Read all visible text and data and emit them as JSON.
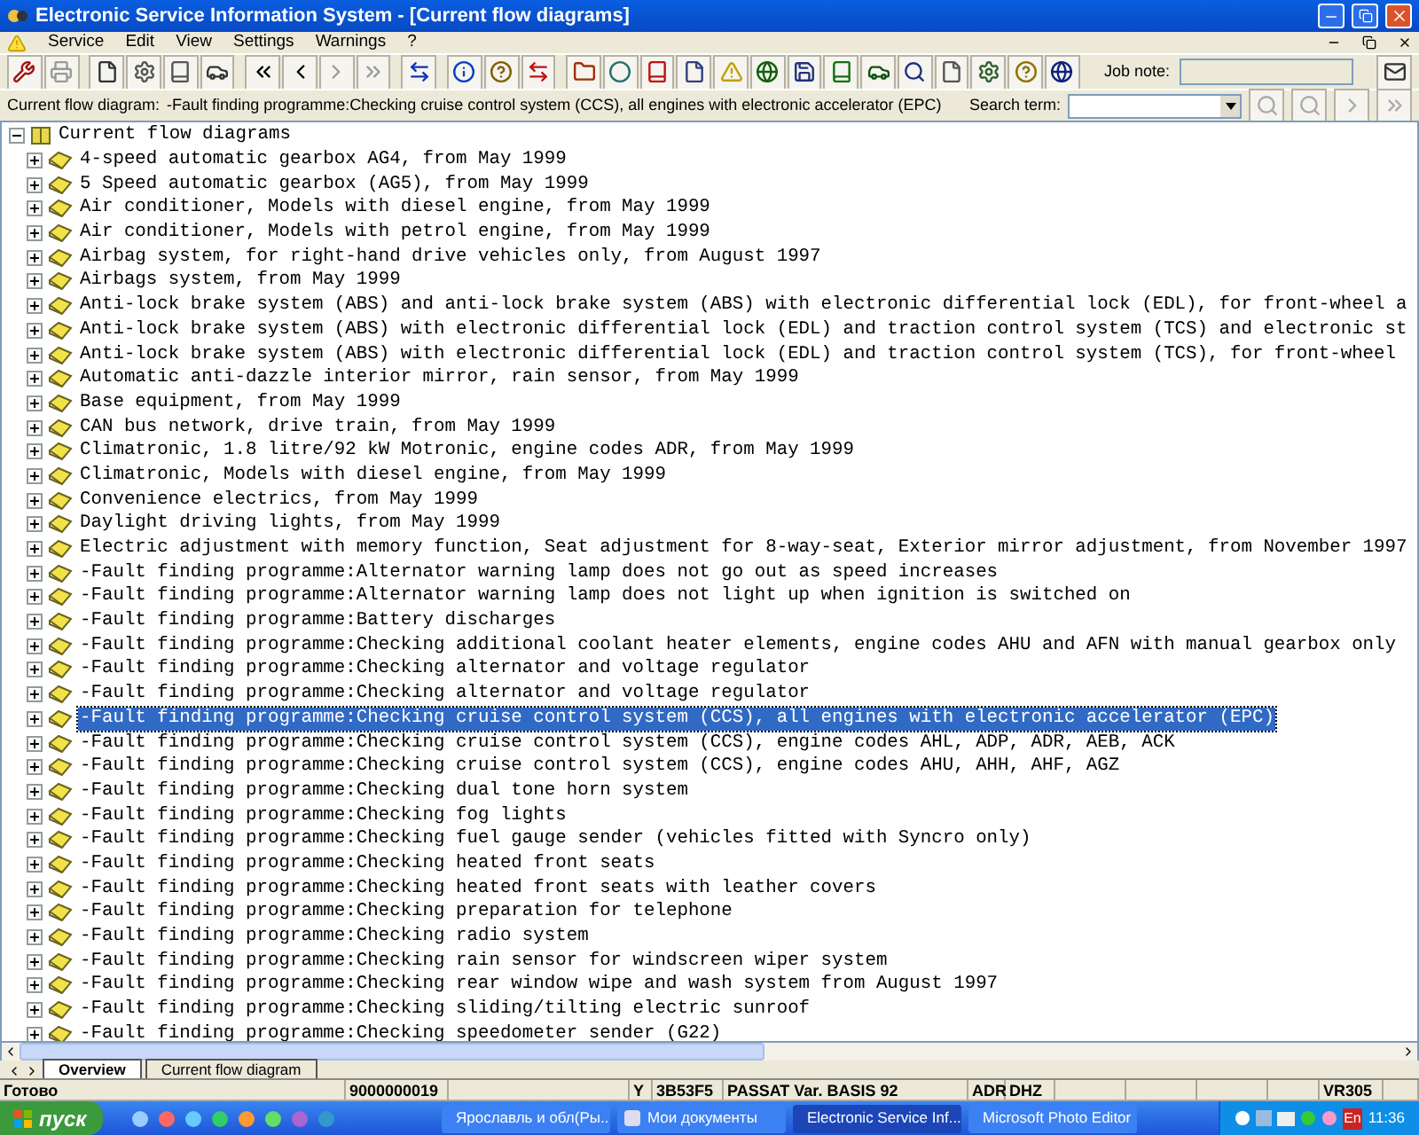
{
  "window": {
    "title": "Electronic Service Information System - [Current flow diagrams]"
  },
  "menu": [
    {
      "label": "Service"
    },
    {
      "label": "Edit"
    },
    {
      "label": "View"
    },
    {
      "label": "Settings"
    },
    {
      "label": "Warnings"
    },
    {
      "label": "?"
    }
  ],
  "toolbar": {
    "job_note_label": "Job note:"
  },
  "info_bar": {
    "label": "Current flow diagram:",
    "value": "-Fault finding programme:Checking cruise control system (CCS), all engines with electronic accelerator (EPC)",
    "search_label": "Search term:"
  },
  "tree": {
    "label": "Current flow diagrams",
    "expanded": true,
    "children": [
      {
        "label": "4-speed automatic gearbox AG4, from May 1999",
        "expanded": false,
        "selected": false
      },
      {
        "label": "5 Speed automatic gearbox (AG5), from May 1999",
        "expanded": false,
        "selected": false
      },
      {
        "label": "Air conditioner, Models with diesel engine, from May 1999",
        "expanded": false,
        "selected": false
      },
      {
        "label": "Air conditioner, Models with petrol engine, from May 1999",
        "expanded": false,
        "selected": false
      },
      {
        "label": "Airbag system, for right-hand drive vehicles only, from August 1997",
        "expanded": false,
        "selected": false
      },
      {
        "label": "Airbags system, from May 1999",
        "expanded": false,
        "selected": false
      },
      {
        "label": "Anti-lock brake system (ABS) and anti-lock brake system (ABS) with electronic differential lock (EDL), for front-wheel a",
        "expanded": false,
        "selected": false
      },
      {
        "label": "Anti-lock brake system (ABS) with electronic differential lock (EDL) and traction control system (TCS) and electronic st",
        "expanded": false,
        "selected": false
      },
      {
        "label": "Anti-lock brake system (ABS) with electronic differential lock (EDL) and traction control system (TCS), for front-wheel",
        "expanded": false,
        "selected": false
      },
      {
        "label": "Automatic anti-dazzle interior mirror, rain sensor, from May 1999",
        "expanded": false,
        "selected": false
      },
      {
        "label": "Base equipment, from May 1999",
        "expanded": false,
        "selected": false
      },
      {
        "label": "CAN bus network, drive train, from May 1999",
        "expanded": false,
        "selected": false
      },
      {
        "label": "Climatronic, 1.8 litre/92 kW Motronic, engine codes ADR, from May 1999",
        "expanded": false,
        "selected": false
      },
      {
        "label": "Climatronic, Models with diesel engine, from May 1999",
        "expanded": false,
        "selected": false
      },
      {
        "label": "Convenience electrics, from May 1999",
        "expanded": false,
        "selected": false
      },
      {
        "label": "Daylight driving lights, from May 1999",
        "expanded": false,
        "selected": false
      },
      {
        "label": "Electric adjustment with memory function, Seat adjustment for 8-way-seat, Exterior mirror adjustment, from November 1997",
        "expanded": false,
        "selected": false
      },
      {
        "label": "-Fault finding programme:Alternator warning lamp does not go out as speed increases",
        "expanded": false,
        "selected": false
      },
      {
        "label": "-Fault finding programme:Alternator warning lamp does not light up when ignition is switched on",
        "expanded": false,
        "selected": false
      },
      {
        "label": "-Fault finding programme:Battery discharges",
        "expanded": false,
        "selected": false
      },
      {
        "label": "-Fault finding programme:Checking additional coolant heater elements, engine codes AHU and AFN with manual gearbox only",
        "expanded": false,
        "selected": false
      },
      {
        "label": "-Fault finding programme:Checking alternator and voltage regulator",
        "expanded": false,
        "selected": false
      },
      {
        "label": "-Fault finding programme:Checking alternator and voltage regulator",
        "expanded": false,
        "selected": false
      },
      {
        "label": "-Fault finding programme:Checking cruise control system (CCS), all engines with electronic accelerator (EPC)",
        "expanded": false,
        "selected": true
      },
      {
        "label": "-Fault finding programme:Checking cruise control system (CCS), engine codes AHL, ADP, ADR, AEB, ACK",
        "expanded": false,
        "selected": false
      },
      {
        "label": "-Fault finding programme:Checking cruise control system (CCS), engine codes AHU, AHH, AHF, AGZ",
        "expanded": false,
        "selected": false
      },
      {
        "label": "-Fault finding programme:Checking dual tone horn system",
        "expanded": false,
        "selected": false
      },
      {
        "label": "-Fault finding programme:Checking fog lights",
        "expanded": false,
        "selected": false
      },
      {
        "label": "-Fault finding programme:Checking fuel gauge sender (vehicles fitted with Syncro only)",
        "expanded": false,
        "selected": false
      },
      {
        "label": "-Fault finding programme:Checking heated front seats",
        "expanded": false,
        "selected": false
      },
      {
        "label": "-Fault finding programme:Checking heated front seats with leather covers",
        "expanded": false,
        "selected": false
      },
      {
        "label": "-Fault finding programme:Checking preparation for telephone",
        "expanded": false,
        "selected": false
      },
      {
        "label": "-Fault finding programme:Checking radio system",
        "expanded": false,
        "selected": false
      },
      {
        "label": "-Fault finding programme:Checking rain sensor for windscreen wiper system",
        "expanded": false,
        "selected": false
      },
      {
        "label": "-Fault finding programme:Checking rear window wipe and wash system from August 1997",
        "expanded": false,
        "selected": false
      },
      {
        "label": "-Fault finding programme:Checking sliding/tilting electric sunroof",
        "expanded": false,
        "selected": false
      },
      {
        "label": "-Fault finding programme:Checking speedometer sender (G22)",
        "expanded": false,
        "selected": false
      }
    ]
  },
  "tabs": [
    {
      "label": "Overview",
      "selected": true
    },
    {
      "label": "Current flow diagram",
      "selected": false
    }
  ],
  "status_bar": [
    "Готово",
    "9000000019",
    "Y",
    "3B53F5",
    "PASSAT Var. BASIS 92",
    "ADR",
    "DHZ",
    "VR305"
  ],
  "taskbar": {
    "start": "пуск",
    "tasks": [
      {
        "label": "Ярославль и обл(Ры...",
        "selected": false
      },
      {
        "label": "Мои документы",
        "selected": false
      },
      {
        "label": "Electronic Service Inf...",
        "selected": true
      },
      {
        "label": "Microsoft Photo Editor",
        "selected": false
      }
    ],
    "language": "En",
    "clock": "11:36"
  }
}
